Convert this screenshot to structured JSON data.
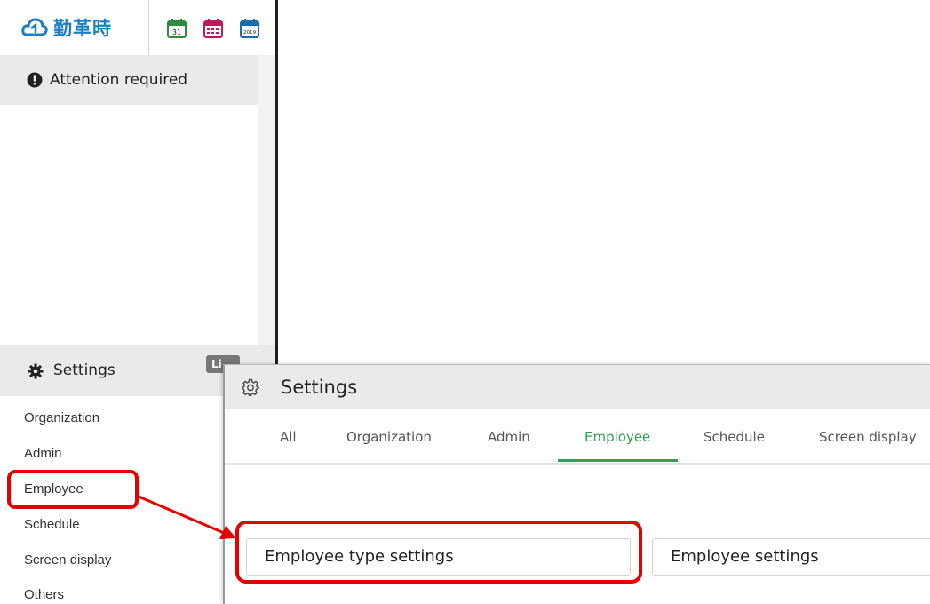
{
  "header": {
    "logo_text": "勤革時",
    "calendar_icons": [
      "calendar-31-icon",
      "calendar-month-icon",
      "calendar-year-icon"
    ],
    "calendar_labels": [
      "31",
      "2019"
    ]
  },
  "attention": {
    "label": "Attention required"
  },
  "settings_section": {
    "label": "Settings",
    "badge": "Li",
    "items": [
      "Organization",
      "Admin",
      "Employee",
      "Schedule",
      "Screen display",
      "Others"
    ]
  },
  "dialog": {
    "title": "Settings",
    "tabs": [
      "All",
      "Organization",
      "Admin",
      "Employee",
      "Schedule",
      "Screen display"
    ],
    "active_tab": "Employee",
    "buttons": [
      "Employee type settings",
      "Employee settings"
    ]
  },
  "colors": {
    "brand_blue": "#1a7fc4",
    "active_green": "#2ea24e",
    "highlight_red": "#e60000"
  }
}
